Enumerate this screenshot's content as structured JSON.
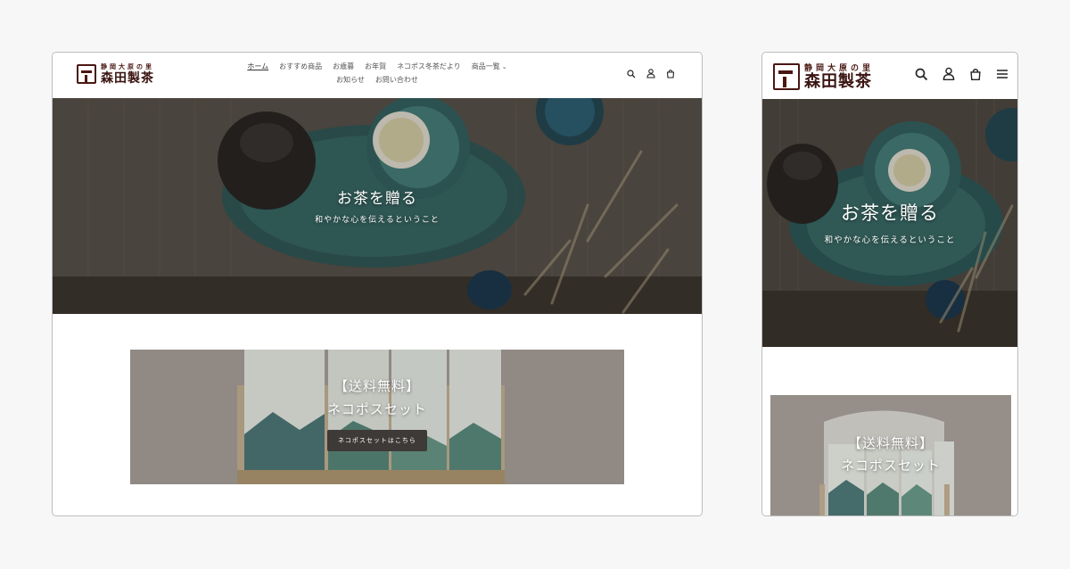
{
  "logo": {
    "tagline": "静岡大原の里",
    "name": "森田製茶"
  },
  "nav": {
    "items": [
      {
        "label": "ホーム"
      },
      {
        "label": "おすすめ商品"
      },
      {
        "label": "お歳暮"
      },
      {
        "label": "お年賀"
      },
      {
        "label": "ネコポス冬茶だより"
      },
      {
        "label": "商品一覧"
      },
      {
        "label": "お知らせ"
      },
      {
        "label": "お問い合わせ"
      }
    ]
  },
  "icons": {
    "search": "search-icon",
    "account": "account-icon",
    "cart": "cart-icon",
    "menu": "hamburger-menu-icon"
  },
  "hero": {
    "title": "お茶を贈る",
    "subtitle": "和やかな心を伝えるということ"
  },
  "promo": {
    "line1": "【送料無料】",
    "line2": "ネコポスセット",
    "button": "ネコポスセットはこちら"
  },
  "colors": {
    "brand": "#4a1713",
    "button": "#3e3a38"
  }
}
